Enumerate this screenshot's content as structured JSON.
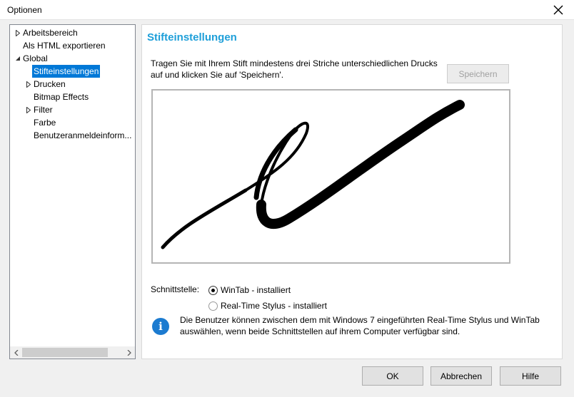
{
  "window": {
    "title": "Optionen"
  },
  "tree": {
    "items": [
      {
        "label": "Arbeitsbereich",
        "expander": "collapsed",
        "level": 0
      },
      {
        "label": "Als HTML exportieren",
        "expander": "none",
        "level": 0
      },
      {
        "label": "Global",
        "expander": "expanded",
        "level": 0
      },
      {
        "label": "Stifteinstellungen",
        "expander": "none",
        "level": 1,
        "selected": true
      },
      {
        "label": "Drucken",
        "expander": "collapsed",
        "level": 1
      },
      {
        "label": "Bitmap Effects",
        "expander": "none",
        "level": 1
      },
      {
        "label": "Filter",
        "expander": "collapsed",
        "level": 1
      },
      {
        "label": "Farbe",
        "expander": "none",
        "level": 1
      },
      {
        "label": "Benutzeranmeldeinform...",
        "expander": "none",
        "level": 1
      }
    ]
  },
  "pane": {
    "title": "Stifteinstellungen",
    "instructions": "Tragen Sie mit Ihrem Stift mindestens drei Striche unterschiedlichen Drucks auf und klicken Sie auf 'Speichern'.",
    "save_label": "Speichern",
    "interface_label": "Schnittstelle:",
    "radio_options": [
      {
        "label": "WinTab - installiert",
        "checked": true
      },
      {
        "label": "Real-Time Stylus - installiert",
        "checked": false
      }
    ],
    "info_text": "Die Benutzer können zwischen dem mit Windows 7 eingeführten Real-Time Stylus und WinTab auswählen, wenn beide Schnittstellen auf ihrem Computer verfügbar sind.",
    "info_icon": "i"
  },
  "footer": {
    "ok_label": "OK",
    "cancel_label": "Abbrechen",
    "help_label": "Hilfe"
  },
  "colors": {
    "accent": "#1e9fd9",
    "selection": "#0078d7",
    "info": "#1c7bd0"
  }
}
